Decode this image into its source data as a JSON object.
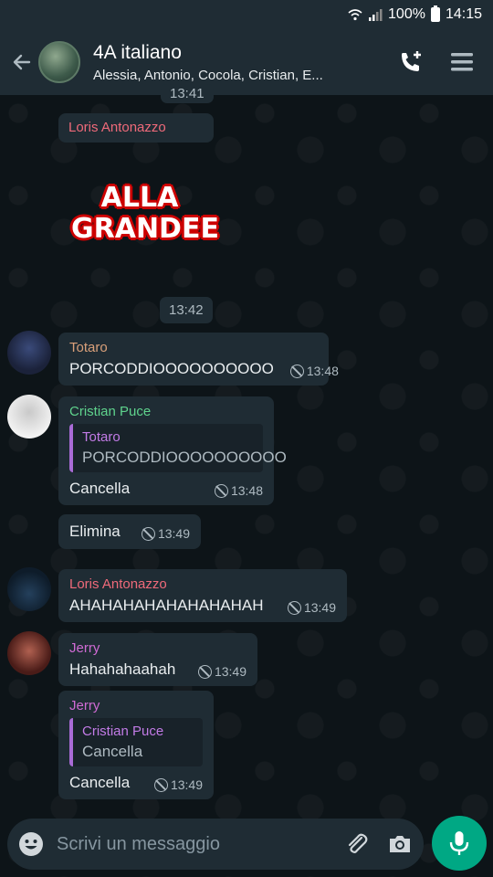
{
  "status_bar": {
    "battery": "100%",
    "time": "14:15"
  },
  "header": {
    "title": "4A italiano",
    "subtitle": "Alessia, Antonio, Cocola, Cristian, E..."
  },
  "messages": {
    "top_partial_time": "13:41",
    "m1": {
      "sender": "Loris Antonazzo",
      "sticker_line1": "ALLA",
      "sticker_line2": "GRANDEE"
    },
    "date_chip": "13:42",
    "m2": {
      "sender": "Totaro",
      "text": "PORCODDIOOOOOOOOOO",
      "time": "13:48"
    },
    "m3": {
      "sender": "Cristian Puce",
      "quote_name": "Totaro",
      "quote_text": "PORCODDIOOOOOOOOOO",
      "text": "Cancella",
      "time": "13:48"
    },
    "m4": {
      "text": "Elimina",
      "time": "13:49"
    },
    "m5": {
      "sender": "Loris Antonazzo",
      "text": "AHAHAHAHAHAHAHAHAH",
      "time": "13:49"
    },
    "m6": {
      "sender": "Jerry",
      "text": "Hahahahaahah",
      "time": "13:49"
    },
    "m7": {
      "sender": "Jerry",
      "quote_name": "Cristian Puce",
      "quote_text": "Cancella",
      "text": "Cancella",
      "time": "13:49"
    }
  },
  "input": {
    "placeholder": "Scrivi un messaggio"
  },
  "colors": {
    "loris": "#ef6a7a",
    "totaro": "#d9a07a",
    "cristian": "#5fd38d",
    "jerry": "#d06bd4",
    "accent": "#00a884"
  },
  "icons": [
    "wifi-icon",
    "signal-icon",
    "battery-icon",
    "back-arrow-icon",
    "add-call-icon",
    "menu-icon",
    "blocked-icon",
    "emoji-icon",
    "attach-icon",
    "camera-icon",
    "mic-icon"
  ]
}
